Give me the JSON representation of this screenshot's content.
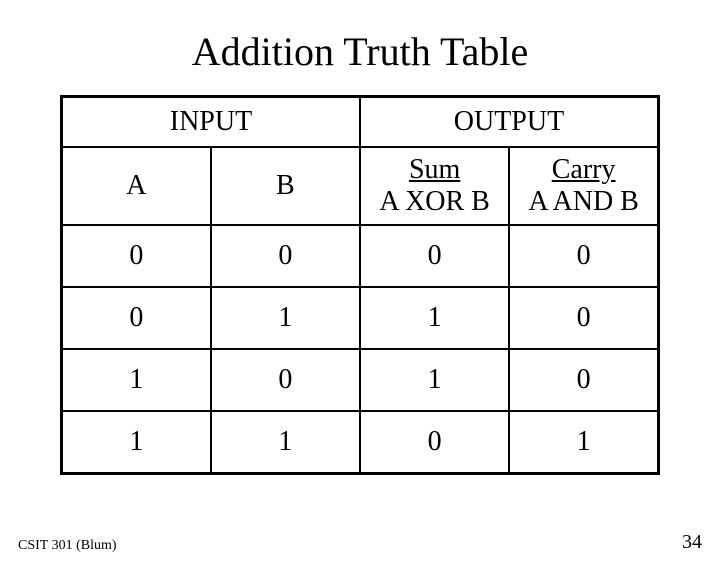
{
  "title": "Addition Truth Table",
  "headers": {
    "input_group": "INPUT",
    "output_group": "OUTPUT",
    "a": "A",
    "b": "B",
    "sum_top": "Sum",
    "sum_bottom": "A XOR B",
    "carry_top": "Carry",
    "carry_bottom": "A AND B"
  },
  "rows": [
    {
      "a": "0",
      "b": "0",
      "sum": "0",
      "carry": "0"
    },
    {
      "a": "0",
      "b": "1",
      "sum": "1",
      "carry": "0"
    },
    {
      "a": "1",
      "b": "0",
      "sum": "1",
      "carry": "0"
    },
    {
      "a": "1",
      "b": "1",
      "sum": "0",
      "carry": "1"
    }
  ],
  "footer": {
    "course": "CSIT 301 (Blum)",
    "page": "34"
  },
  "chart_data": {
    "type": "table",
    "title": "Addition Truth Table",
    "columns": [
      "A",
      "B",
      "Sum (A XOR B)",
      "Carry (A AND B)"
    ],
    "rows": [
      [
        0,
        0,
        0,
        0
      ],
      [
        0,
        1,
        1,
        0
      ],
      [
        1,
        0,
        1,
        0
      ],
      [
        1,
        1,
        0,
        1
      ]
    ]
  }
}
